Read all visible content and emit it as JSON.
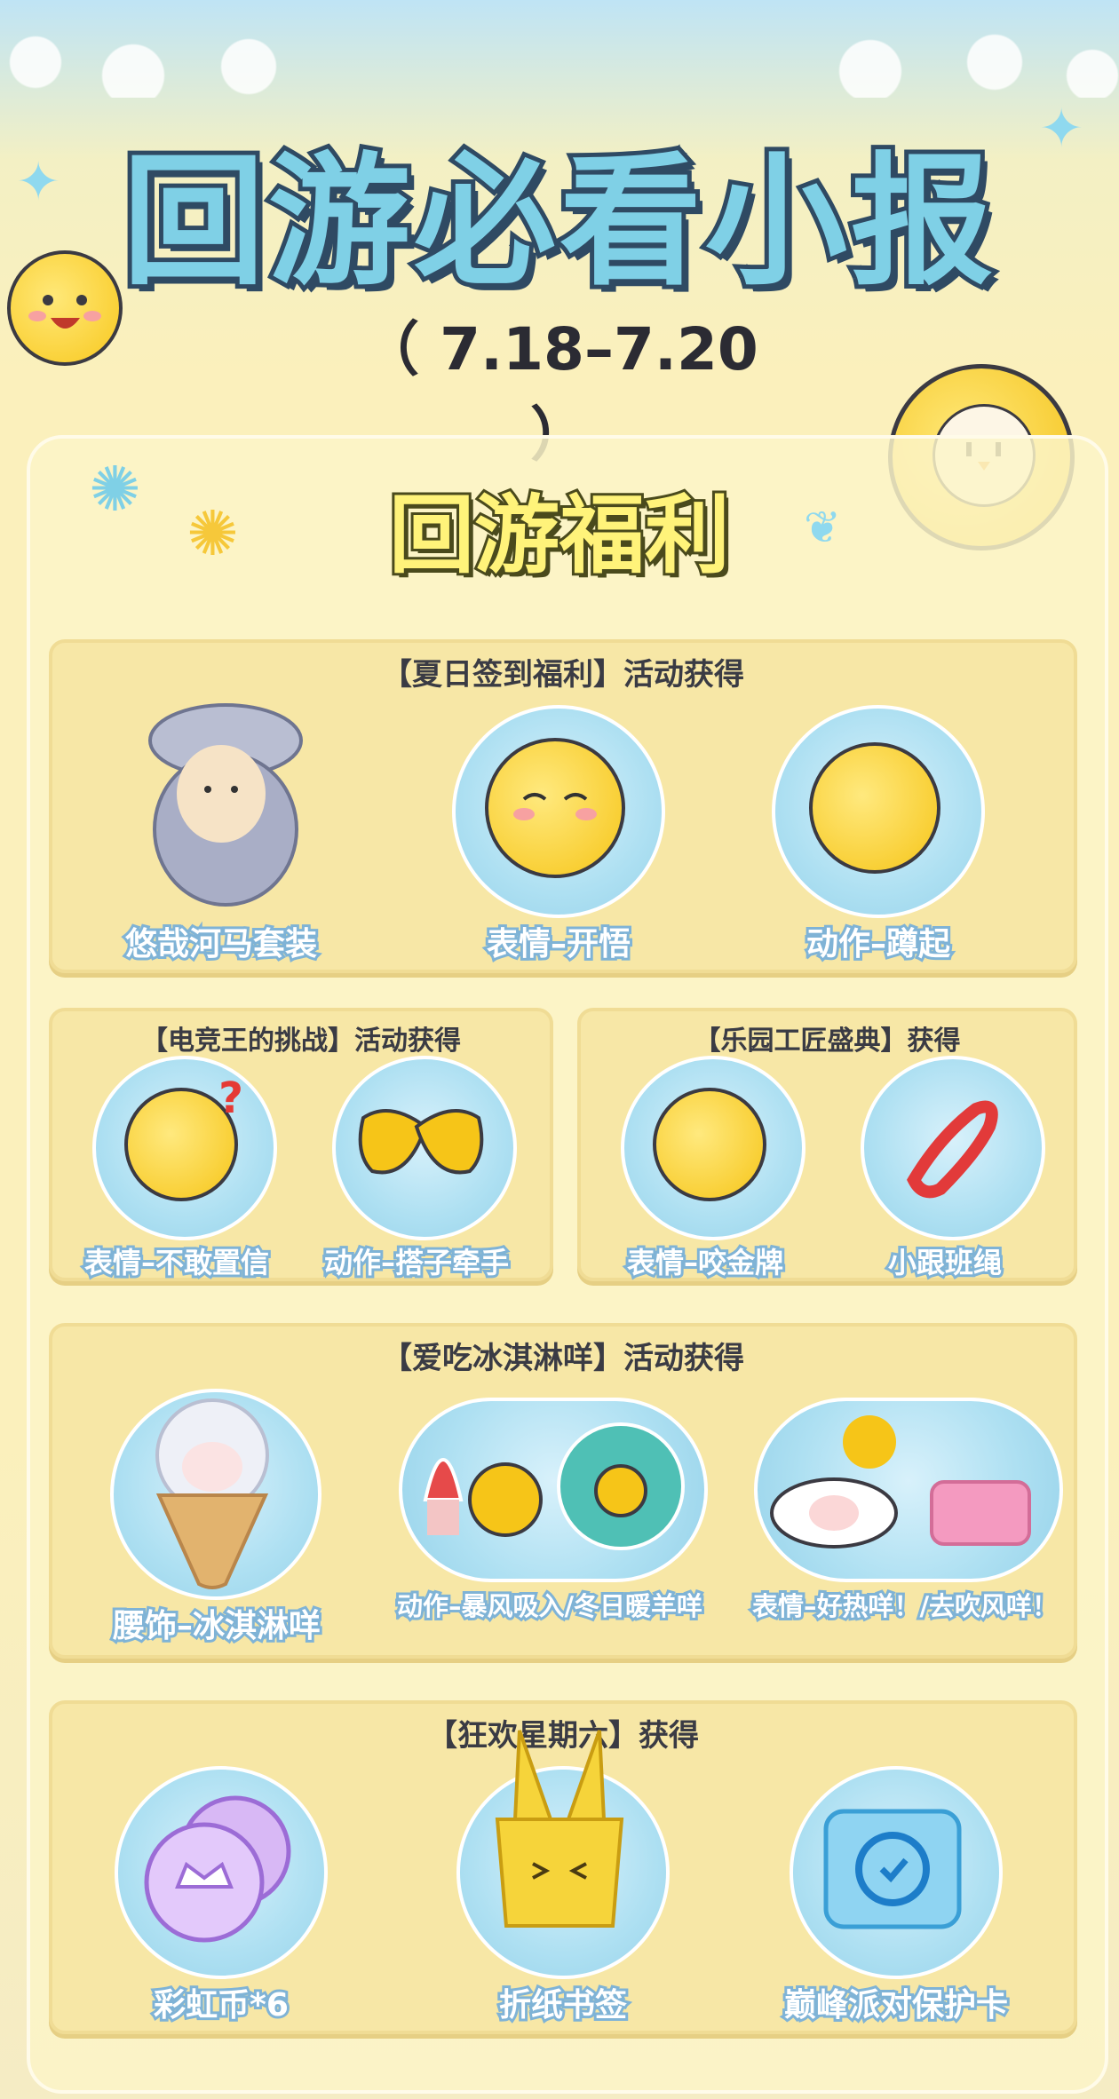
{
  "header": {
    "title": "回游必看小报",
    "date": "（ 7.18–7.20 ）"
  },
  "subtitle": "回游福利",
  "sections": [
    {
      "title": "【夏日签到福利】活动获得",
      "items": [
        {
          "label": "悠哉河马套装",
          "icon": "hippo-suit-icon"
        },
        {
          "label": "表情–开悟",
          "icon": "enlightened-emote-icon"
        },
        {
          "label": "动作–蹲起",
          "icon": "squat-action-icon"
        }
      ]
    },
    {
      "title": "【电竞王的挑战】活动获得",
      "items": [
        {
          "label": "表情–不敢置信",
          "icon": "disbelief-emote-icon"
        },
        {
          "label": "动作–搭子牵手",
          "icon": "hold-hands-action-icon"
        }
      ]
    },
    {
      "title": "【乐园工匠盛典】获得",
      "items": [
        {
          "label": "表情–咬金牌",
          "icon": "bite-medal-emote-icon"
        },
        {
          "label": "小跟班绳",
          "icon": "leash-rope-icon"
        }
      ]
    },
    {
      "title": "【爱吃冰淇淋咩】活动获得",
      "items": [
        {
          "label": "腰饰–冰淇淋咩",
          "icon": "ice-cream-sheep-waist-icon"
        },
        {
          "label": "动作–暴风吸入/冬日暖羊咩",
          "icon": "storm-inhale-action-icon"
        },
        {
          "label": "表情–好热咩！/去吹风咩！",
          "icon": "hot-sheep-emote-icon"
        }
      ]
    },
    {
      "title": "【狂欢星期六】获得",
      "items": [
        {
          "label": "彩虹币*6",
          "icon": "rainbow-coin-icon"
        },
        {
          "label": "折纸书签",
          "icon": "origami-bookmark-icon"
        },
        {
          "label": "巅峰派对保护卡",
          "icon": "protection-card-icon"
        }
      ]
    }
  ],
  "colors": {
    "background": "#fbf0b8",
    "card": "#f7e7a6",
    "label_stroke": "#7fb3d6",
    "title_fill": "#7fd0e6",
    "title_stroke": "#2f4a63"
  }
}
